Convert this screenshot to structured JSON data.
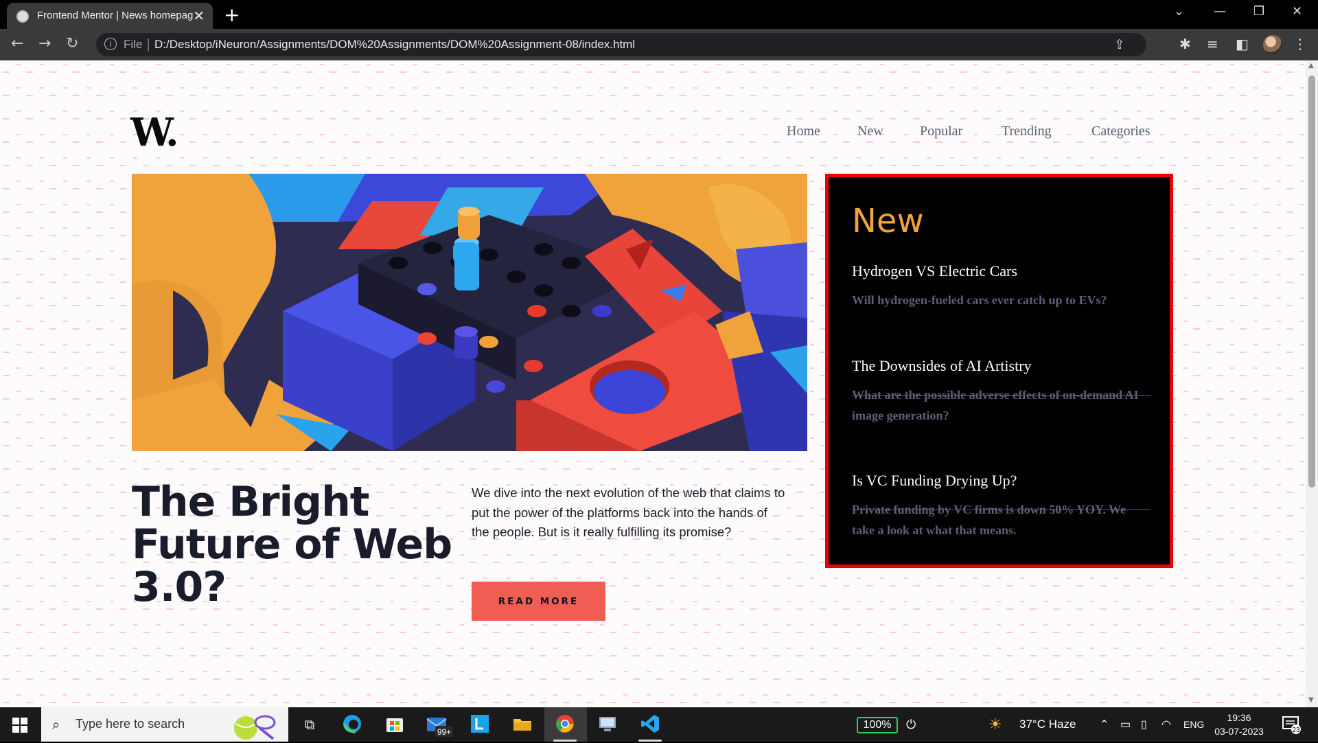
{
  "browser": {
    "tab_title": "Frontend Mentor | News homepage",
    "tab_close": "✕",
    "new_tab": "+",
    "omnibox_scheme": "File",
    "omnibox_url": "D:/Desktop/iNeuron/Assignments/DOM%20Assignments/DOM%20Assignment-08/index.html"
  },
  "page": {
    "logo": "W.",
    "nav": [
      "Home",
      "New",
      "Popular",
      "Trending",
      "Categories"
    ],
    "headline": "The Bright Future of Web 3.0?",
    "intro": "We dive into the next evolution of the web that claims to put the power of the platforms back into the hands of the people. But is it really fulfilling its promise?",
    "read_more": "READ MORE",
    "new_panel": {
      "title": "New",
      "items": [
        {
          "title": "Hydrogen VS Electric Cars",
          "text": "Will hydrogen-fueled cars ever catch up to EVs?"
        },
        {
          "title": "The Downsides of AI Artistry",
          "text": "What are the possible adverse effects of on-demand AI image generation?"
        },
        {
          "title": "Is VC Funding Drying Up?",
          "text": "Private funding by VC firms is down 50% YOY. We take a look at what that means."
        }
      ]
    }
  },
  "taskbar": {
    "search_placeholder": "Type here to search",
    "mail_badge": "99+",
    "battery": "100%",
    "weather": "37°C  Haze",
    "language": "ENG",
    "time": "19:36",
    "date": "03-07-2023",
    "notification_count": "23"
  },
  "colors": {
    "accent_orange": "#f4a23c",
    "button_red": "#ef5d53",
    "panel_border": "#ee0000",
    "dark_navy": "#1b1c2b",
    "muted_text": "#5d5f79"
  }
}
